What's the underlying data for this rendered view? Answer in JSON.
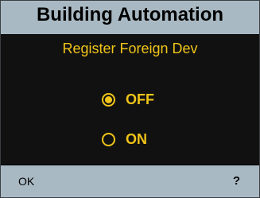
{
  "header": {
    "title": "Building Automation"
  },
  "main": {
    "subtitle": "Register Foreign Dev",
    "options": [
      {
        "label": "OFF",
        "selected": true
      },
      {
        "label": "ON",
        "selected": false
      }
    ]
  },
  "footer": {
    "ok_label": "OK",
    "help_label": "?"
  },
  "colors": {
    "accent": "#f0c419",
    "panel_bg": "#a9b9c3",
    "content_bg": "#111111"
  }
}
